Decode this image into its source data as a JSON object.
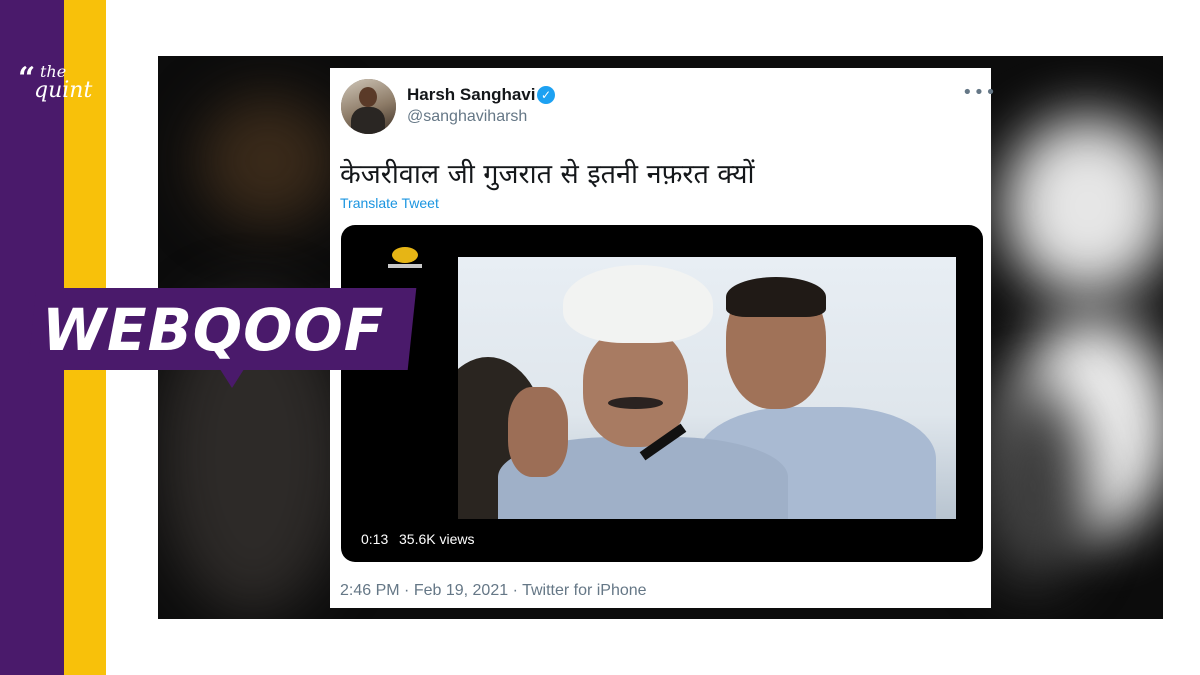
{
  "brand": {
    "logo_quote": "“",
    "logo_line1": "the",
    "logo_line2": "quint",
    "colors": {
      "purple": "#4a1a6b",
      "yellow": "#f8c10a"
    }
  },
  "badge": {
    "label": "WEBQOOF"
  },
  "tweet": {
    "author_name": "Harsh Sanghavi",
    "verified_mark": "✓",
    "handle": "@sanghaviharsh",
    "more_icon": "•••",
    "text": "केजरीवाल जी गुजरात से इतनी नफ़रत क्यों",
    "translate_label": "Translate Tweet",
    "video": {
      "duration": "0:13",
      "views": "35.6K views"
    },
    "time": "2:46 PM",
    "separator": "·",
    "date": "Feb 19, 2021",
    "source": "Twitter for iPhone"
  }
}
